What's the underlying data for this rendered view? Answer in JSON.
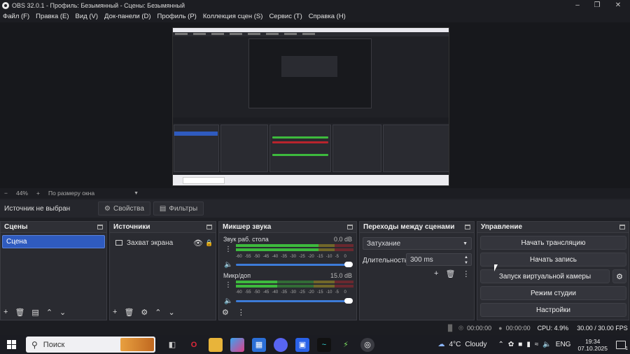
{
  "window": {
    "title": "OBS 32.0.1 - Профиль: Безымянный - Сцены: Безымянный"
  },
  "menu": [
    "Файл (F)",
    "Правка (E)",
    "Вид (V)",
    "Док-панели (D)",
    "Профиль (P)",
    "Коллекция сцен (S)",
    "Сервис (T)",
    "Справка (H)"
  ],
  "zoom": {
    "minus": "−",
    "value": "44%",
    "plus": "+",
    "fit_label": "По размеру окна"
  },
  "source_bar": {
    "none_selected": "Источник не выбран",
    "properties": "Свойства",
    "filters": "Фильтры"
  },
  "scenes": {
    "title": "Сцены",
    "items": [
      "Сцена"
    ]
  },
  "sources": {
    "title": "Источники",
    "items": [
      "Захват экрана"
    ]
  },
  "mixer": {
    "title": "Микшер звука",
    "channels": [
      {
        "name": "Звук раб. стола",
        "db": "0.0 dB",
        "level": 0.7
      },
      {
        "name": "Микр/доп",
        "db": "15.0 dB",
        "level": 0.35
      }
    ],
    "scale": [
      "-60",
      "-55",
      "-50",
      "-45",
      "-40",
      "-35",
      "-30",
      "-25",
      "-20",
      "-15",
      "-10",
      "-5",
      "0"
    ]
  },
  "transitions": {
    "title": "Переходы между сценами",
    "selected": "Затухание",
    "duration_label": "Длительность",
    "duration_value": "300 ms"
  },
  "controls": {
    "title": "Управление",
    "start_stream": "Начать трансляцию",
    "start_record": "Начать запись",
    "virtual_cam": "Запуск виртуальной камеры",
    "studio_mode": "Режим студии",
    "settings": "Настройки"
  },
  "status": {
    "stream_time": "00:00:00",
    "record_time": "00:00:00",
    "cpu": "CPU: 4.9%",
    "fps": "30.00 / 30.00 FPS"
  },
  "taskbar": {
    "search_placeholder": "Поиск",
    "weather_temp": "4°C",
    "weather_text": "Cloudy",
    "lang": "ENG",
    "time": "19:34",
    "date": "07.10.2025",
    "notif": "1"
  },
  "colors": {
    "accent": "#2f5bbf",
    "meter_green": "#3dba3d",
    "meter_yellow": "#c8b020",
    "meter_red": "#b8242c",
    "slider_blue": "#3d7bd8"
  }
}
